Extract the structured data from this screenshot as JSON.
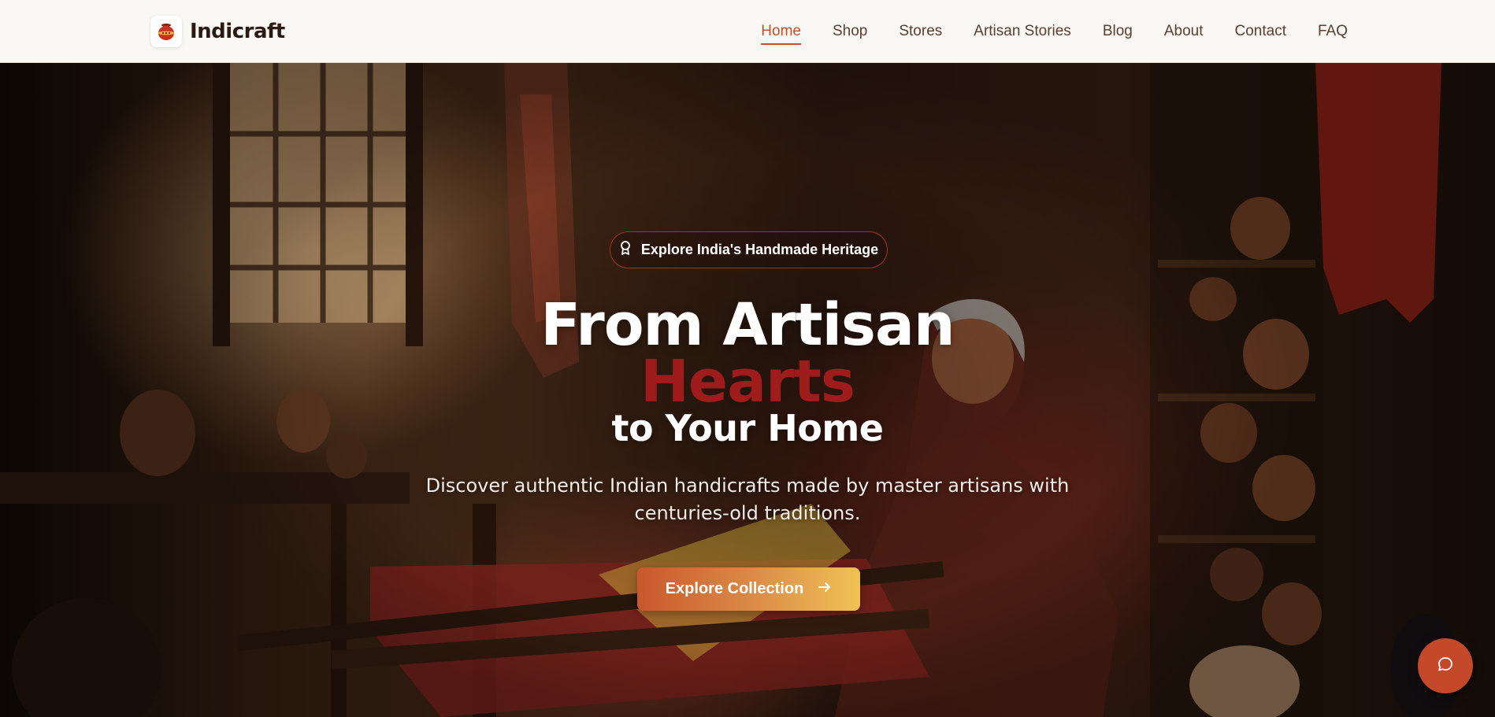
{
  "brand": {
    "name": "Indicraft",
    "icon": "clay-pot-logo-icon"
  },
  "nav": {
    "items": [
      {
        "label": "Home",
        "active": true
      },
      {
        "label": "Shop",
        "active": false
      },
      {
        "label": "Stores",
        "active": false
      },
      {
        "label": "Artisan Stories",
        "active": false
      },
      {
        "label": "Blog",
        "active": false
      },
      {
        "label": "About",
        "active": false
      },
      {
        "label": "Contact",
        "active": false
      },
      {
        "label": "FAQ",
        "active": false
      }
    ]
  },
  "hero": {
    "badge": {
      "label": "Explore India's Handmade Heritage",
      "icon": "award-ribbon-icon"
    },
    "headline_line1": "From Artisan",
    "headline_line2": "Hearts",
    "headline_line3": "to Your Home",
    "subtitle": "Discover authentic Indian handicrafts made by master artisans with centuries-old traditions.",
    "cta": {
      "label": "Explore Collection",
      "icon": "arrow-right-icon"
    }
  },
  "chat": {
    "icon": "chat-bubble-icon"
  },
  "colors": {
    "accent": "#c4502a",
    "headline_highlight": "#9e1c1c",
    "cta_start": "#c8582e",
    "cta_end": "#efc256",
    "nav_bg": "#faf8f5"
  }
}
